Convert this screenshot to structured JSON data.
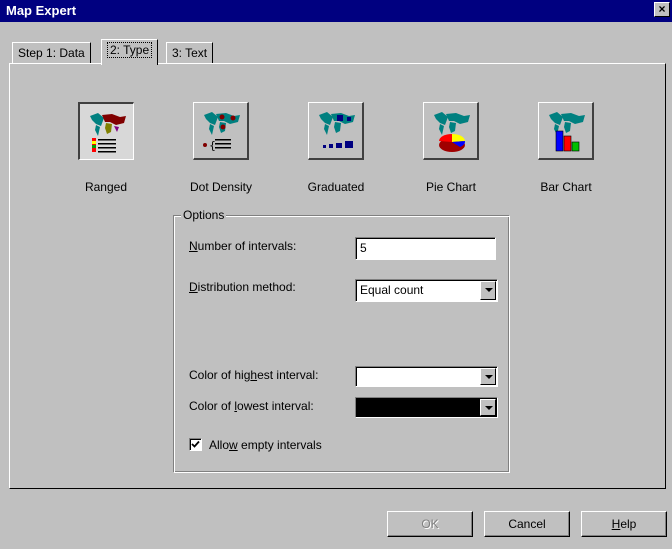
{
  "window": {
    "title": "Map Expert",
    "close_glyph": "×"
  },
  "tabs": [
    {
      "label": "Step 1: Data",
      "active": false
    },
    {
      "label": "2: Type",
      "active": true
    },
    {
      "label": "3: Text",
      "active": false
    }
  ],
  "map_types": [
    {
      "label": "Ranged",
      "icon": "ranged-map-icon",
      "selected": true
    },
    {
      "label": "Dot Density",
      "icon": "dot-density-map-icon",
      "selected": false
    },
    {
      "label": "Graduated",
      "icon": "graduated-map-icon",
      "selected": false
    },
    {
      "label": "Pie Chart",
      "icon": "pie-chart-map-icon",
      "selected": false
    },
    {
      "label": "Bar Chart",
      "icon": "bar-chart-map-icon",
      "selected": false
    }
  ],
  "options": {
    "group_title": "Options",
    "intervals_label_pre": "",
    "intervals_label_u": "N",
    "intervals_label_post": "umber of intervals:",
    "intervals_value": "5",
    "distribution_label_pre": "",
    "distribution_label_u": "D",
    "distribution_label_post": "istribution method:",
    "distribution_value": "Equal count",
    "highest_label_pre": "Color of hig",
    "highest_label_u": "h",
    "highest_label_post": "est interval:",
    "highest_color": "#ffffff",
    "lowest_label_pre": "Color of ",
    "lowest_label_u": "l",
    "lowest_label_post": "owest interval:",
    "lowest_color": "#000000",
    "allow_empty_label_pre": "Allo",
    "allow_empty_label_u": "w",
    "allow_empty_label_post": " empty intervals",
    "allow_empty_checked": true
  },
  "buttons": {
    "ok": "OK",
    "cancel": "Cancel",
    "help_u": "H",
    "help_post": "elp"
  },
  "colors": {
    "titlebar": "#000080",
    "dialog": "#c0c0c0"
  }
}
